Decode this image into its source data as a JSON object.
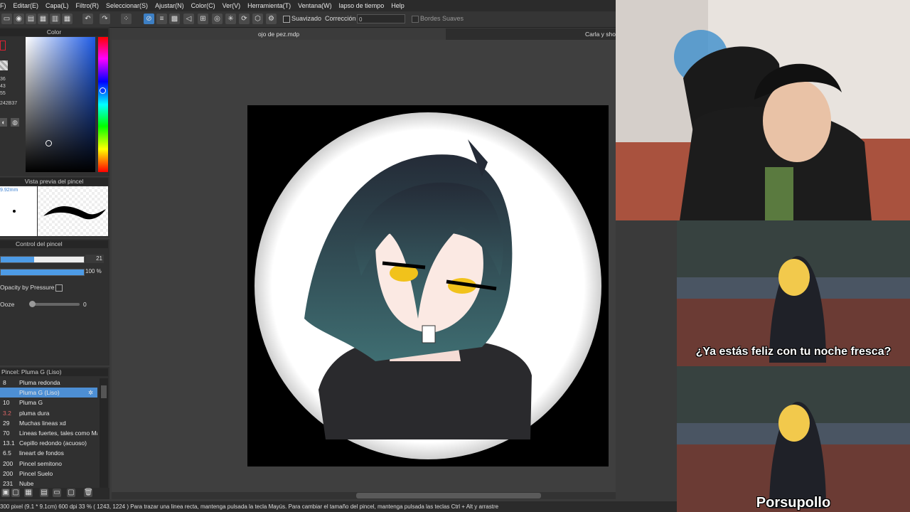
{
  "menu": [
    "F)",
    "Editar(E)",
    "Capa(L)",
    "Filtro(R)",
    "Seleccionar(S)",
    "Ajustar(N)",
    "Color(C)",
    "Ver(V)",
    "Herramienta(T)",
    "Ventana(W)",
    "lapso de tiempo",
    "Help"
  ],
  "toolbar": {
    "smoothing_label": "Suavizado",
    "correction_label": "Corrección",
    "correction_value": "0",
    "soft_edges_label": "Bordes Suaves"
  },
  "color_panel": {
    "title": "Color",
    "values": [
      "36",
      "43",
      "55",
      "242B37"
    ]
  },
  "brush_preview": {
    "title": "Vista previa del pincel",
    "size": "9.92mm"
  },
  "brush_control": {
    "title": "Control del pincel",
    "size_value": "21",
    "opacity_value": "100 %",
    "opacity_by_pressure": "Opacity by Pressure",
    "ooze_label": "Ooze",
    "ooze_value": "0"
  },
  "brush_list": {
    "title": "Pincel: Pluma G (Liso)",
    "items": [
      {
        "size": "8",
        "name": "Pluma redonda"
      },
      {
        "size": "",
        "name": "Pluma G (Liso)"
      },
      {
        "size": "10",
        "name": "Pluma G"
      },
      {
        "size": "3.2",
        "name": "pluma dura"
      },
      {
        "size": "29",
        "name": "Muchas lineas xd"
      },
      {
        "size": "70",
        "name": "Lineas fuertes, tales como Ma"
      },
      {
        "size": "13.1",
        "name": "Cepillo redondo (acuoso)"
      },
      {
        "size": "6.5",
        "name": "lineart de fondos"
      },
      {
        "size": "200",
        "name": "Pincel semitono"
      },
      {
        "size": "200",
        "name": "Pincel Suelo"
      },
      {
        "size": "231",
        "name": "Nube"
      }
    ]
  },
  "tabs": {
    "file": "ojo de pez.mdp",
    "other": "Carla y sho"
  },
  "status": {
    "info": "300 pixel   (9.1 * 9.1cm)   600 dpi   33 %   ( 1243, 1224 )   Para trazar una linea recta, mantenga pulsada la tecla Mayús. Para cambiar el tamaño del pincel, mantenga pulsada las teclas Ctrl + Alt y arrastre"
  },
  "meme": {
    "caption_top": "¿Ya estás feliz con tu noche fresca?",
    "caption_bottom": "Porsupollo"
  },
  "colors": {
    "accent": "#3d7fc4",
    "selected_row": "#4d8fd4",
    "current_color": "#242B37"
  }
}
